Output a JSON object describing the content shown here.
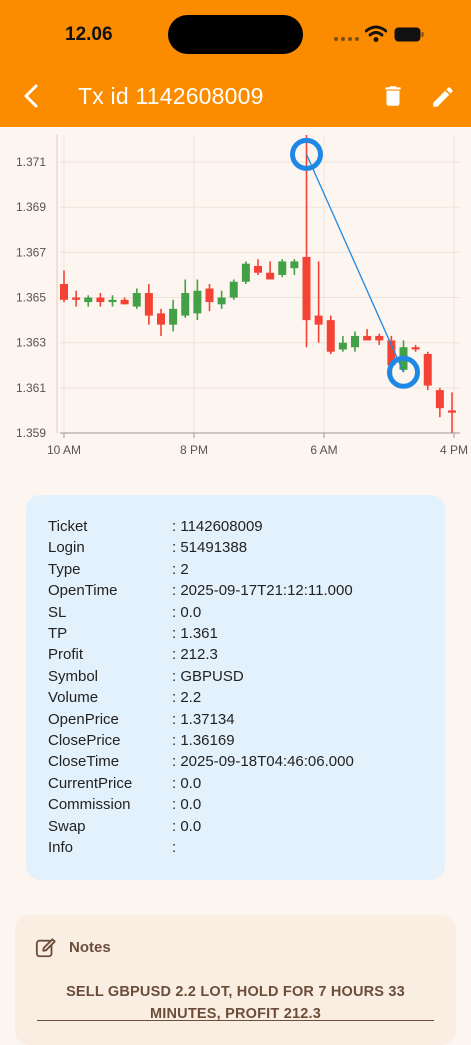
{
  "status": {
    "time": "12.06"
  },
  "header": {
    "title": "Tx id 1142608009"
  },
  "chart_data": {
    "type": "candlestick",
    "y_ticks": [
      1.359,
      1.361,
      1.363,
      1.365,
      1.367,
      1.369,
      1.371
    ],
    "y_tick_labels": [
      "1.359",
      "1.361",
      "1.363",
      "1.365",
      "1.367",
      "1.369",
      "1.371"
    ],
    "x_tick_labels": [
      "10 AM",
      "8 PM",
      "6 AM",
      "4 PM"
    ],
    "ylim": [
      1.359,
      1.3722
    ],
    "grid": true,
    "candles": [
      {
        "o": 1.3656,
        "h": 1.3662,
        "l": 1.3648,
        "c": 1.3649
      },
      {
        "o": 1.365,
        "h": 1.3653,
        "l": 1.3646,
        "c": 1.3649
      },
      {
        "o": 1.3648,
        "h": 1.3651,
        "l": 1.3646,
        "c": 1.365
      },
      {
        "o": 1.365,
        "h": 1.3652,
        "l": 1.3646,
        "c": 1.3648
      },
      {
        "o": 1.3648,
        "h": 1.3651,
        "l": 1.3646,
        "c": 1.3649
      },
      {
        "o": 1.3649,
        "h": 1.365,
        "l": 1.3647,
        "c": 1.3647
      },
      {
        "o": 1.3646,
        "h": 1.3654,
        "l": 1.3645,
        "c": 1.3652
      },
      {
        "o": 1.3652,
        "h": 1.3656,
        "l": 1.3638,
        "c": 1.3642
      },
      {
        "o": 1.3643,
        "h": 1.3645,
        "l": 1.3633,
        "c": 1.3638
      },
      {
        "o": 1.3638,
        "h": 1.3649,
        "l": 1.3635,
        "c": 1.3645
      },
      {
        "o": 1.3642,
        "h": 1.3658,
        "l": 1.3641,
        "c": 1.3652
      },
      {
        "o": 1.3643,
        "h": 1.3658,
        "l": 1.364,
        "c": 1.3653
      },
      {
        "o": 1.3654,
        "h": 1.3656,
        "l": 1.3644,
        "c": 1.3648
      },
      {
        "o": 1.3647,
        "h": 1.3653,
        "l": 1.3645,
        "c": 1.365
      },
      {
        "o": 1.365,
        "h": 1.3658,
        "l": 1.3649,
        "c": 1.3657
      },
      {
        "o": 1.3657,
        "h": 1.3666,
        "l": 1.3656,
        "c": 1.3665
      },
      {
        "o": 1.3664,
        "h": 1.3667,
        "l": 1.366,
        "c": 1.3661
      },
      {
        "o": 1.3661,
        "h": 1.3666,
        "l": 1.3659,
        "c": 1.3658
      },
      {
        "o": 1.366,
        "h": 1.3667,
        "l": 1.3659,
        "c": 1.3666
      },
      {
        "o": 1.3663,
        "h": 1.3667,
        "l": 1.366,
        "c": 1.3666
      },
      {
        "o": 1.3668,
        "h": 1.3722,
        "l": 1.3628,
        "c": 1.364
      },
      {
        "o": 1.3642,
        "h": 1.3666,
        "l": 1.363,
        "c": 1.3638
      },
      {
        "o": 1.364,
        "h": 1.3642,
        "l": 1.3625,
        "c": 1.3626
      },
      {
        "o": 1.3627,
        "h": 1.3633,
        "l": 1.3626,
        "c": 1.363
      },
      {
        "o": 1.3628,
        "h": 1.3635,
        "l": 1.3626,
        "c": 1.3633
      },
      {
        "o": 1.3633,
        "h": 1.3636,
        "l": 1.3631,
        "c": 1.3631
      },
      {
        "o": 1.3633,
        "h": 1.3634,
        "l": 1.3629,
        "c": 1.3631
      },
      {
        "o": 1.3631,
        "h": 1.3633,
        "l": 1.3614,
        "c": 1.362
      },
      {
        "o": 1.3618,
        "h": 1.3631,
        "l": 1.3617,
        "c": 1.3628
      },
      {
        "o": 1.3628,
        "h": 1.3629,
        "l": 1.3626,
        "c": 1.3627
      },
      {
        "o": 1.3625,
        "h": 1.3626,
        "l": 1.3609,
        "c": 1.3611
      },
      {
        "o": 1.3609,
        "h": 1.361,
        "l": 1.3597,
        "c": 1.3601
      },
      {
        "o": 1.36,
        "h": 1.3608,
        "l": 1.359,
        "c": 1.3599
      }
    ],
    "markers": [
      {
        "label": "open",
        "index": 20,
        "price": 1.37134
      },
      {
        "label": "close",
        "index": 28,
        "price": 1.36169
      }
    ],
    "colors": {
      "up": "#43a047",
      "down": "#f44336",
      "marker": "#1e88e5",
      "line": "#1e88e5"
    }
  },
  "details": [
    {
      "key": "Ticket",
      "value": ": 1142608009"
    },
    {
      "key": "Login",
      "value": ": 51491388"
    },
    {
      "key": "Type",
      "value": ": 2"
    },
    {
      "key": "OpenTime",
      "value": ": 2025-09-17T21:12:11.000"
    },
    {
      "key": "SL",
      "value": ": 0.0"
    },
    {
      "key": "TP",
      "value": ": 1.361"
    },
    {
      "key": "Profit",
      "value": ": 212.3"
    },
    {
      "key": "Symbol",
      "value": ": GBPUSD"
    },
    {
      "key": "Volume",
      "value": ": 2.2"
    },
    {
      "key": "OpenPrice",
      "value": ": 1.37134"
    },
    {
      "key": "ClosePrice",
      "value": ": 1.36169"
    },
    {
      "key": "CloseTime",
      "value": ": 2025-09-18T04:46:06.000"
    },
    {
      "key": "CurrentPrice",
      "value": ": 0.0"
    },
    {
      "key": "Commission",
      "value": ": 0.0"
    },
    {
      "key": "Swap",
      "value": ": 0.0"
    },
    {
      "key": "Info",
      "value": ":"
    }
  ],
  "notes": {
    "title": "Notes",
    "text": "SELL GBPUSD 2.2 LOT, HOLD FOR 7 HOURS 33 MINUTES, PROFIT 212.3"
  },
  "theme": {
    "app_bar": "#fb8c00",
    "info_card": "#e3f1fc",
    "notes_card": "#faeee3"
  }
}
